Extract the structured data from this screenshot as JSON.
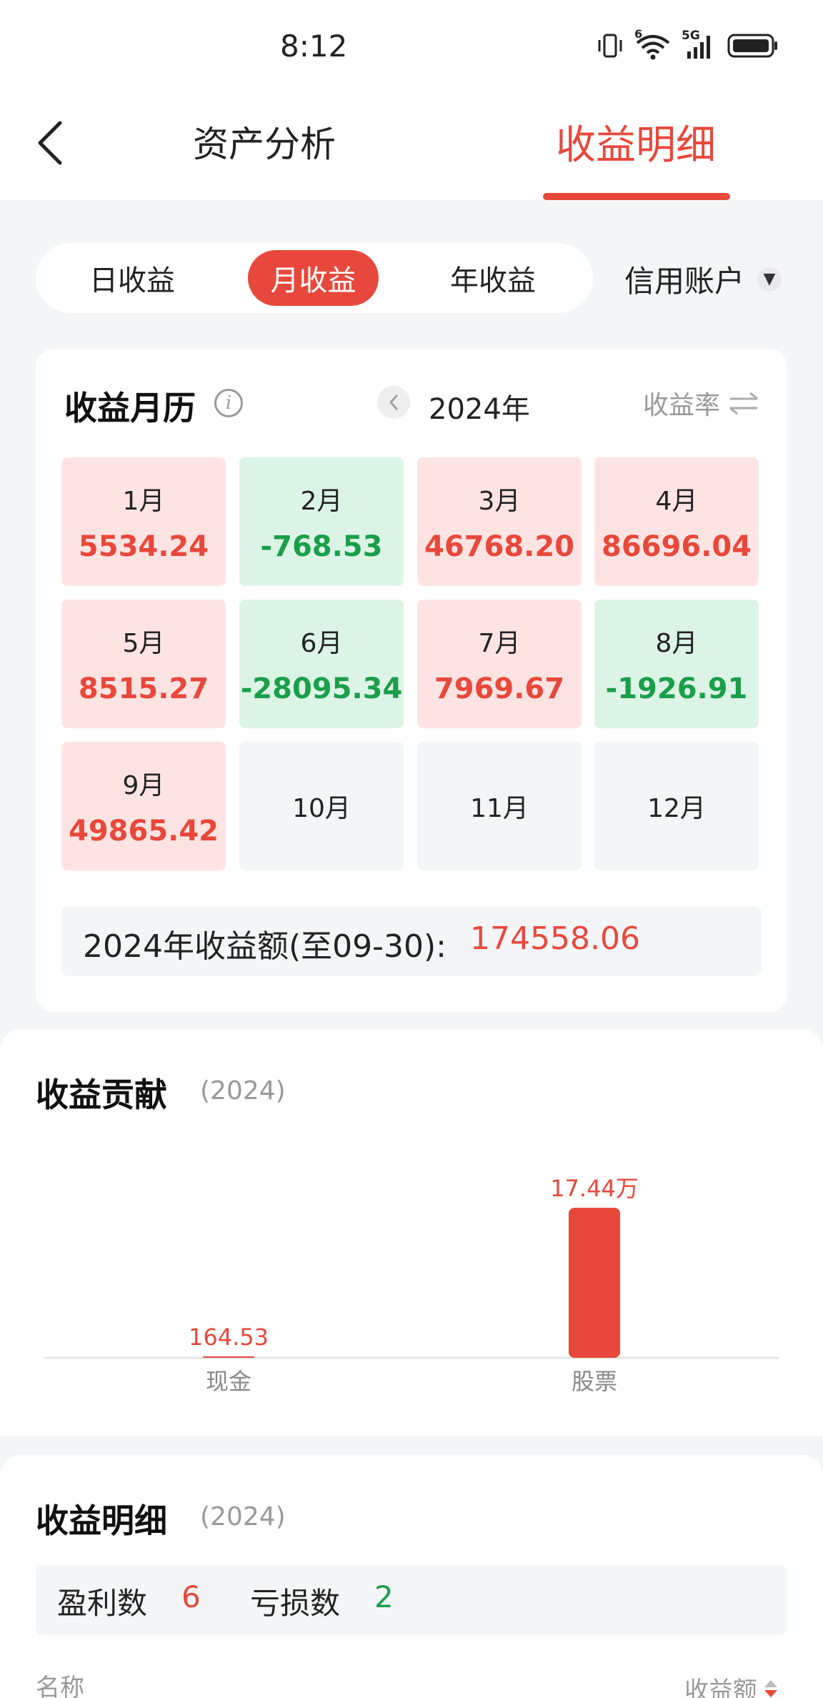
{
  "status_bar": {
    "time": "8:12",
    "wifi_badge": "6",
    "network": "5G"
  },
  "header": {
    "tab_asset": "资产分析",
    "tab_detail": "收益明细"
  },
  "period_tabs": {
    "day": "日收益",
    "month": "月收益",
    "year": "年收益",
    "selected": "月收益"
  },
  "account": {
    "selected": "信用账户"
  },
  "calendar": {
    "title": "收益月历",
    "year": "2024年",
    "rate_toggle": "收益率",
    "months": [
      {
        "name": "1月",
        "value": "5534.24",
        "state": "pos"
      },
      {
        "name": "2月",
        "value": "-768.53",
        "state": "neg"
      },
      {
        "name": "3月",
        "value": "46768.20",
        "state": "pos"
      },
      {
        "name": "4月",
        "value": "86696.04",
        "state": "pos"
      },
      {
        "name": "5月",
        "value": "8515.27",
        "state": "pos"
      },
      {
        "name": "6月",
        "value": "-28095.34",
        "state": "neg"
      },
      {
        "name": "7月",
        "value": "7969.67",
        "state": "pos"
      },
      {
        "name": "8月",
        "value": "-1926.91",
        "state": "neg"
      },
      {
        "name": "9月",
        "value": "49865.42",
        "state": "pos"
      },
      {
        "name": "10月",
        "value": "",
        "state": "empty"
      },
      {
        "name": "11月",
        "value": "",
        "state": "empty"
      },
      {
        "name": "12月",
        "value": "",
        "state": "empty"
      }
    ],
    "total_label": "2024年收益额(至09-30):",
    "total_value": "174558.06"
  },
  "contribution": {
    "title": "收益贡献",
    "year": "(2024)"
  },
  "chart_data": {
    "type": "bar",
    "categories": [
      "现金",
      "股票"
    ],
    "values": [
      164.53,
      174400
    ],
    "data_labels": [
      "164.53",
      "17.44万"
    ],
    "ylim": [
      0,
      174400
    ],
    "colors": {
      "bar": "#e8483b",
      "label": "#e8483b",
      "axis": "#e5e5e5",
      "tick": "#888888"
    },
    "grid": false,
    "legend": "none"
  },
  "detail": {
    "title": "收益明细",
    "year": "(2024)",
    "profit_label": "盈利数",
    "profit_count": "6",
    "loss_label": "亏损数",
    "loss_count": "2",
    "col_name": "名称",
    "col_amount": "收益额"
  },
  "colors": {
    "accent": "#e8483b",
    "gain": "#e8483b",
    "loss": "#1a9e4a"
  }
}
